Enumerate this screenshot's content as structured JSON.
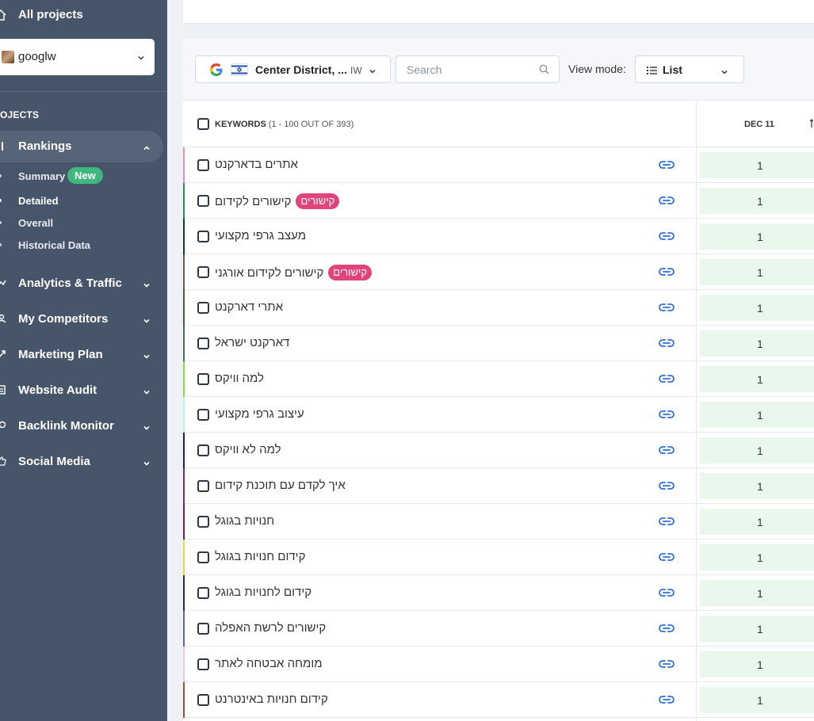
{
  "sidebar": {
    "all_projects": "All projects",
    "project_name": "googlw",
    "section_label": "OJECTS",
    "rankings": "Rankings",
    "sub_items": [
      {
        "label": "Summary",
        "badge": "New"
      },
      {
        "label": "Detailed"
      },
      {
        "label": "Overall"
      },
      {
        "label": "Historical Data"
      }
    ],
    "nav": [
      {
        "label": "Analytics & Traffic",
        "icon": "analytics-icon"
      },
      {
        "label": "My Competitors",
        "icon": "competitors-icon"
      },
      {
        "label": "Marketing Plan",
        "icon": "marketing-icon"
      },
      {
        "label": "Website Audit",
        "icon": "audit-icon"
      },
      {
        "label": "Backlink Monitor",
        "icon": "backlink-icon"
      },
      {
        "label": "Social Media",
        "icon": "thumbs-up-icon"
      }
    ]
  },
  "toolbar": {
    "location": "Center District, ...",
    "language": "IW",
    "search_placeholder": "Search",
    "view_mode_label": "View mode:",
    "view_mode_value": "List"
  },
  "table": {
    "keywords_header": "KEYWORDS",
    "keywords_count": "(1 - 100 OUT OF 393)",
    "date_column": "DEC 11",
    "rows": [
      {
        "keyword": "אתרים בדארקנט",
        "tag": "",
        "rank": "1",
        "color": "#e48fc1"
      },
      {
        "keyword": "קישורים לקידום",
        "tag": "קישורים",
        "rank": "1",
        "color": "#2e8b57"
      },
      {
        "keyword": "מעצב גרפי מקצועי",
        "tag": "",
        "rank": "1",
        "color": "#0b3d3a"
      },
      {
        "keyword": "קישורים לקידום אורגני",
        "tag": "קישורים",
        "rank": "1",
        "color": "#6b5a4a"
      },
      {
        "keyword": "אתרי דארקנט",
        "tag": "",
        "rank": "1",
        "color": "#4a5a3a"
      },
      {
        "keyword": "דארקנט ישראל",
        "tag": "",
        "rank": "1",
        "color": "#4a6a5a"
      },
      {
        "keyword": "למה וויקס",
        "tag": "",
        "rank": "1",
        "color": "#8bd64a"
      },
      {
        "keyword": "עיצוב גרפי מקצועי",
        "tag": "",
        "rank": "1",
        "color": "#b8f0e6"
      },
      {
        "keyword": "למה לא וויקס",
        "tag": "",
        "rank": "1",
        "color": "#1a1f6b"
      },
      {
        "keyword": "איך לקדם עם תוכנת קידום",
        "tag": "",
        "rank": "1",
        "color": "#8a2a5a"
      },
      {
        "keyword": "חנויות בגוגל",
        "tag": "",
        "rank": "1",
        "color": "#8a1a4a"
      },
      {
        "keyword": "קידום חנויות בגוגל",
        "tag": "",
        "rank": "1",
        "color": "#e6d84a"
      },
      {
        "keyword": "קידום לחנויות בגוגל",
        "tag": "",
        "rank": "1",
        "color": "#2a2a6a"
      },
      {
        "keyword": "קישורים לרשת האפלה",
        "tag": "",
        "rank": "1",
        "color": "#5a6a9a"
      },
      {
        "keyword": "מומחה אבטחה לאתר",
        "tag": "",
        "rank": "1",
        "color": "#f2c6d8"
      },
      {
        "keyword": "קידום חנויות באינטרנט",
        "tag": "",
        "rank": "1",
        "color": "#a04a3a"
      }
    ]
  }
}
